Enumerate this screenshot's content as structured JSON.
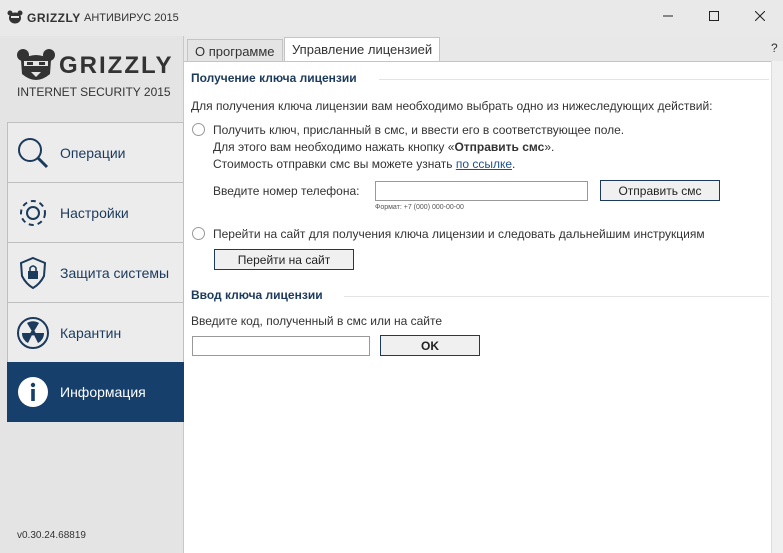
{
  "window": {
    "brand": "GRIZZLY",
    "title": "АНТИВИРУС 2015"
  },
  "sidebar": {
    "logo_text": "GRIZZLY",
    "logo_sub": "INTERNET SECURITY 2015",
    "items": [
      {
        "label": "Операции",
        "icon": "search-icon"
      },
      {
        "label": "Настройки",
        "icon": "gear-icon"
      },
      {
        "label": "Защита системы",
        "icon": "shield-lock-icon"
      },
      {
        "label": "Карантин",
        "icon": "radiation-icon"
      },
      {
        "label": "Информация",
        "icon": "info-icon",
        "active": true
      }
    ],
    "version": "v0.30.24.68819"
  },
  "tabs": [
    {
      "label": "О программе"
    },
    {
      "label": "Управление лицензией",
      "active": true
    }
  ],
  "help_label": "?",
  "license_key": {
    "title": "Получение ключа лицензии",
    "intro": "Для получения ключа лицензии вам необходимо выбрать одно из нижеследующих действий:",
    "option1": {
      "line1": "Получить ключ, присланный в смс, и ввести его в соответствующее поле.",
      "line2_prefix": "Для этого вам необходимо нажать кнопку «",
      "line2_bold": "Отправить смс",
      "line2_suffix": "».",
      "line3_prefix": "Стоимость отправки смс вы можете узнать ",
      "line3_link": "по ссылке",
      "line3_suffix": "."
    },
    "phone_label": "Введите номер телефона:",
    "phone_value": "",
    "phone_hint": "Формат: +7 (000) 000-00-00",
    "send_sms_button": "Отправить смс",
    "option2": {
      "text": "Перейти на сайт для получения ключа лицензии и следовать дальнейшим инструкциям"
    },
    "goto_site_button": "Перейти на сайт"
  },
  "license_input": {
    "title": "Ввод ключа лицензии",
    "label": "Введите код, полученный в смс или на сайте",
    "value": "",
    "ok_button": "OK"
  },
  "colors": {
    "accent": "#173f6c",
    "heading": "#1c3a5c",
    "link": "#1f4f88"
  }
}
